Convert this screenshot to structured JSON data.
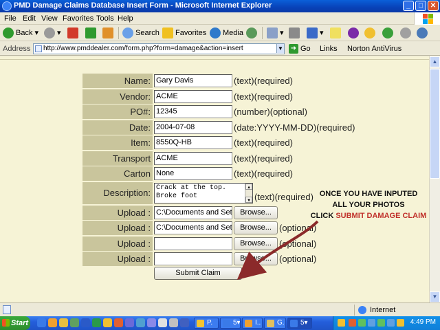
{
  "window": {
    "title": "PMD Damage Claims Database Insert Form - Microsoft Internet Explorer",
    "minimize": "_",
    "maximize": "□",
    "close": "✕"
  },
  "menu": [
    "File",
    "Edit",
    "View",
    "Favorites",
    "Tools",
    "Help"
  ],
  "toolbar": {
    "back": "Back",
    "search": "Search",
    "favorites": "Favorites",
    "media": "Media"
  },
  "address": {
    "label": "Address",
    "url": "http://www.pmddealer.com/form.php?form=damage&action=insert",
    "go": "Go",
    "links": "Links",
    "norton": "Norton AntiVirus"
  },
  "form": {
    "rows": [
      {
        "label": "Name:",
        "value": "Gary Davis",
        "note": "(text)(required)"
      },
      {
        "label": "Vendor:",
        "value": "ACME",
        "note": "(text)(required)"
      },
      {
        "label": "PO#:",
        "value": "12345",
        "note": "(number)(optional)"
      },
      {
        "label": "Date:",
        "value": "2004-07-08",
        "note": "(date:YYYY-MM-DD)(required)"
      },
      {
        "label": "Item:",
        "value": "8550Q-HB",
        "note": "(text)(required)"
      },
      {
        "label": "Transport Carrier:",
        "value": "ACME",
        "note": "(text)(required)"
      },
      {
        "label": "Carton Damage?:",
        "value": "None",
        "note": "(text)(required)"
      }
    ],
    "description": {
      "label": "Description:",
      "line1": "Crack at the top.",
      "line2": "Broke foot",
      "note": "(text)(required)"
    },
    "uploads": [
      {
        "label": "Upload :",
        "value": "C:\\Documents and Setti",
        "button": "Browse...",
        "note": ""
      },
      {
        "label": "Upload :",
        "value": "C:\\Documents and Setti",
        "button": "Browse...",
        "note": "(optional)"
      },
      {
        "label": "Upload :",
        "value": "",
        "button": "Browse...",
        "note": "(optional)"
      },
      {
        "label": "Upload :",
        "value": "",
        "button": "Browse...",
        "note": "(optional)"
      }
    ],
    "submit": "Submit Claim"
  },
  "instruction": {
    "line1": "ONCE YOU HAVE INPUTED",
    "line2": "ALL YOUR PHOTOS",
    "line3_prefix": "CLICK",
    "line3_highlight": "SUBMIT DAMAGE CLAIM"
  },
  "status": {
    "zone": "Internet"
  },
  "taskbar": {
    "start": "Start",
    "tasks": [
      "P.",
      "5▾",
      "I..",
      "G.",
      "5▾"
    ],
    "time": "4:49 PM"
  },
  "colors": {
    "label_bg": "#c9c59c",
    "page_bg": "#f6f3d6",
    "highlight_red": "#c0302a"
  }
}
